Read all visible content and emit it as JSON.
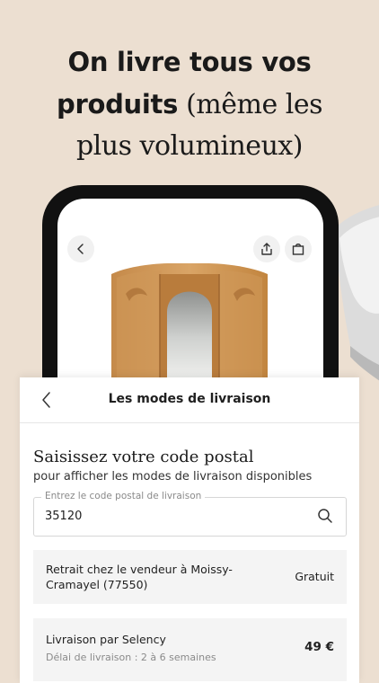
{
  "headline": {
    "line1": "On livre tous vos",
    "line2_bold": "produits",
    "line2_serif": " (même les",
    "line3": "plus volumineux)"
  },
  "product": {
    "image": "wardrobe-image"
  },
  "sheet": {
    "title": "Les modes de livraison",
    "prompt_title": "Saisissez votre code postal",
    "prompt_subtitle": "pour afficher les modes de livraison disponibles",
    "input": {
      "label": "Entrez le code postal de livraison",
      "value": "35120"
    },
    "options": [
      {
        "label": "Retrait chez le vendeur à Moissy-Cramayel (77550)",
        "price": "Gratuit"
      },
      {
        "label": "Livraison par Selency",
        "delay": "Délai de livraison :  2 à 6 semaines",
        "price": "49 €"
      }
    ]
  },
  "icons": [
    "chevron-left-icon",
    "share-icon",
    "bag-icon",
    "search-icon"
  ]
}
